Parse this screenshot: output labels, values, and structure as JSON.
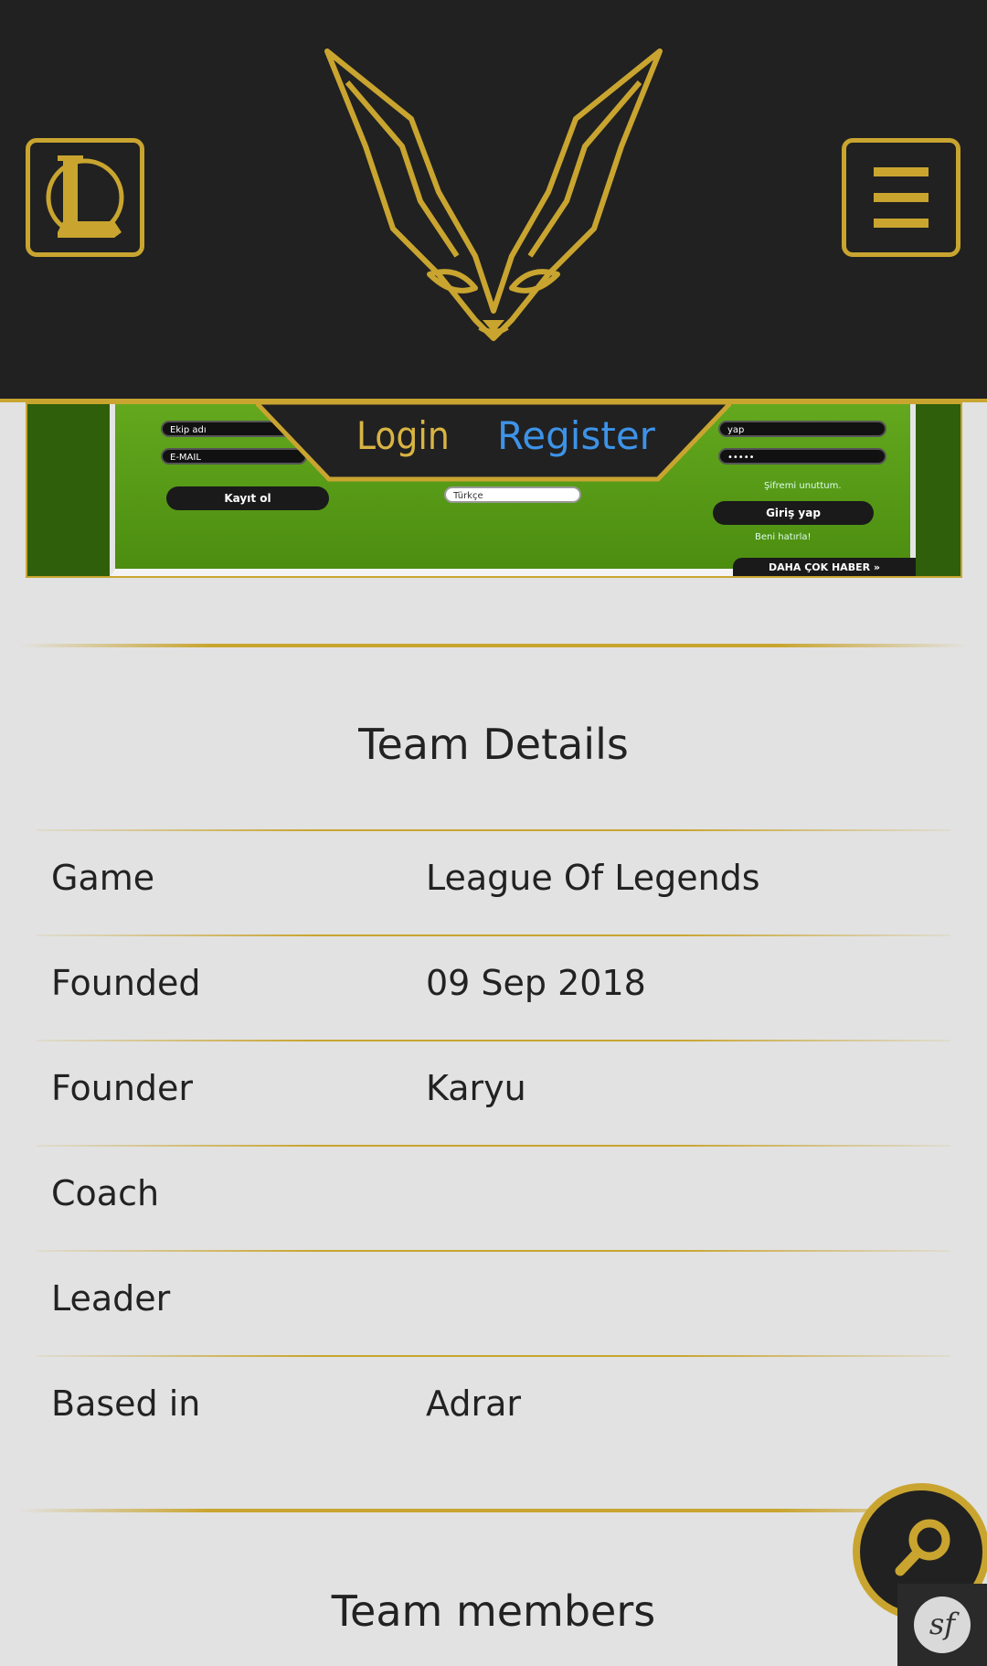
{
  "header": {
    "logo_icon": "league-of-legends-logo-icon",
    "emblem_icon": "fox-mask-icon",
    "menu_icon": "hamburger-menu-icon",
    "accent_color": "#c9a530",
    "background_color": "#212121"
  },
  "auth": {
    "login_label": "Login",
    "register_label": "Register",
    "login_color": "#d8b443",
    "register_color": "#3d93e8"
  },
  "banner": {
    "fields": [
      "Ekip adı",
      "E-MAIL"
    ],
    "right_fields": [
      "yap",
      "•••••"
    ],
    "register_button": "Kayıt ol",
    "language_select": "Türkçe",
    "forgot_password": "Şifremi unuttum.",
    "login_button": "Giriş yap",
    "remember_me": "Beni hatırla!",
    "more_news": "DAHA ÇOK HABER »"
  },
  "team_details": {
    "title": "Team Details",
    "rows": [
      {
        "label": "Game",
        "value": "League Of Legends"
      },
      {
        "label": "Founded",
        "value": "09 Sep 2018"
      },
      {
        "label": "Founder",
        "value": "Karyu"
      },
      {
        "label": "Coach",
        "value": ""
      },
      {
        "label": "Leader",
        "value": ""
      },
      {
        "label": "Based in",
        "value": "Adrar"
      }
    ]
  },
  "team_members": {
    "title": "Team members"
  },
  "fab": {
    "search_icon": "search-icon",
    "symfony_badge": "sf"
  }
}
